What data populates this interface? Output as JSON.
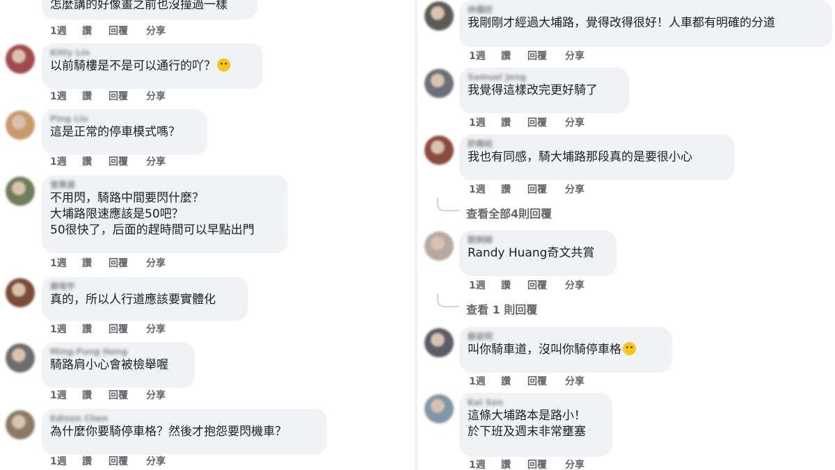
{
  "left": {
    "comments": [
      {
        "author": "",
        "lines": [
          "怎麼講的好像畫之前也沒撞過一樣"
        ],
        "time": "1週",
        "like": "讚",
        "reply": "回覆",
        "share": "分享"
      },
      {
        "author": "Kitty Lin",
        "lines": [
          "以前騎樓是不是可以通行的吖？"
        ],
        "time": "1週",
        "like": "讚",
        "reply": "回覆",
        "share": "分享",
        "emoji": "thinking-face-icon"
      },
      {
        "author": "Ping Liu",
        "lines": [
          "這是正常的停車模式嗎？"
        ],
        "time": "1週",
        "like": "讚",
        "reply": "回覆",
        "share": "分享"
      },
      {
        "author": "曾秉源",
        "lines": [
          "不用閃，騎路中間要閃什麼？",
          "大埔路限速應該是50吧？",
          "50很快了，后面的趕時間可以早點出門"
        ],
        "time": "1週",
        "like": "讚",
        "reply": "回覆",
        "share": "分享"
      },
      {
        "author": "蔡唯宇",
        "lines": [
          "真的，所以人行道應該要實體化"
        ],
        "time": "1週",
        "like": "讚",
        "reply": "回覆",
        "share": "分享"
      },
      {
        "author": "Ming-Fung Hong",
        "lines": [
          "騎路肩小心會被檢舉喔"
        ],
        "time": "1週",
        "like": "讚",
        "reply": "回覆",
        "share": "分享"
      },
      {
        "author": "Edison Chen",
        "lines": [
          "為什麼你要騎停車格？然後才抱怨要閃機車？"
        ],
        "time": "1週",
        "like": "讚",
        "reply": "回覆",
        "share": "分享"
      }
    ]
  },
  "right": {
    "comments": [
      {
        "author": "林儀狀",
        "lines": [
          "我剛剛才經過大埔路，覺得改得很好！人車都有明確的分道"
        ],
        "time": "1週",
        "like": "讚",
        "reply": "回覆",
        "share": "分享"
      },
      {
        "author": "Samuel Jeng",
        "lines": [
          "我覺得這樣改完更好騎了"
        ],
        "time": "1週",
        "like": "讚",
        "reply": "回覆",
        "share": "分享"
      },
      {
        "author": "許韓桂",
        "lines": [
          "我也有同感，騎大埔路那段真的是要很小心"
        ],
        "time": "1週",
        "like": "讚",
        "reply": "回覆",
        "share": "分享",
        "view_replies": "查看全部4則回覆"
      },
      {
        "author": "劉俐綺",
        "lines": [
          "Randy Huang奇文共賞"
        ],
        "time": "1週",
        "like": "讚",
        "reply": "回覆",
        "share": "分享",
        "view_replies": "查看 1 則回覆"
      },
      {
        "author": "蘇姿明",
        "lines": [
          "叫你騎車道，沒叫你騎停車格"
        ],
        "time": "1週",
        "like": "讚",
        "reply": "回覆",
        "share": "分享",
        "emoji": "rolling-eyes-face-icon"
      },
      {
        "author": "Kai Sen",
        "lines": [
          "這條大埔路本是路小！",
          "於下班及週末非常壅塞"
        ],
        "time": "1週",
        "like": "讚",
        "reply": "回覆",
        "share": "分享"
      }
    ]
  },
  "colors": {
    "bubble": "#f0f2f5",
    "action_text": "#65676b",
    "body_text": "#1c1e21"
  }
}
